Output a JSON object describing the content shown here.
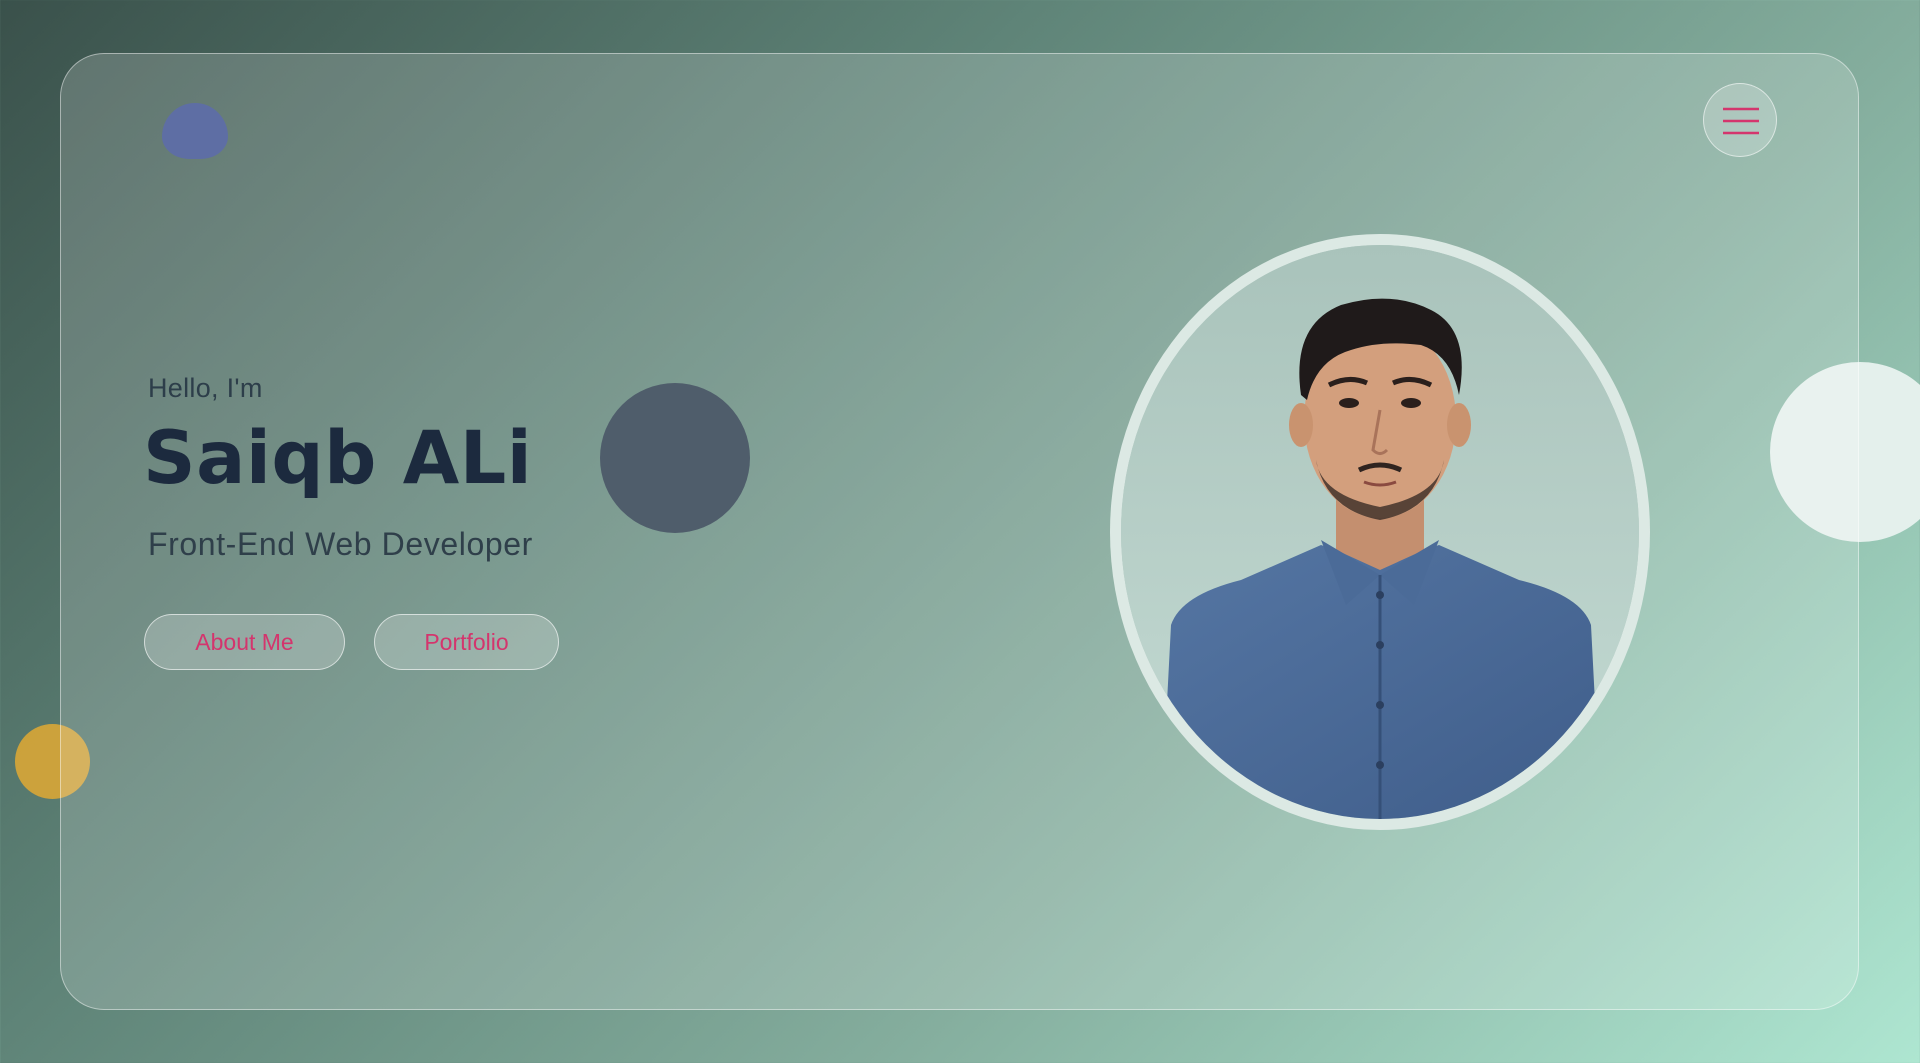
{
  "hero": {
    "greeting": "Hello, I'm",
    "name": "Saiqb ALi",
    "role": "Front-End Web Developer"
  },
  "buttons": {
    "about_label": "About Me",
    "portfolio_label": "Portfolio"
  },
  "icons": {
    "menu": "hamburger-menu-icon"
  },
  "colors": {
    "accent": "#d4356d",
    "heading": "#1c2a3e",
    "background_start": "#3a514b",
    "background_end": "#aee6d1",
    "shirt": "#4a6a98"
  }
}
